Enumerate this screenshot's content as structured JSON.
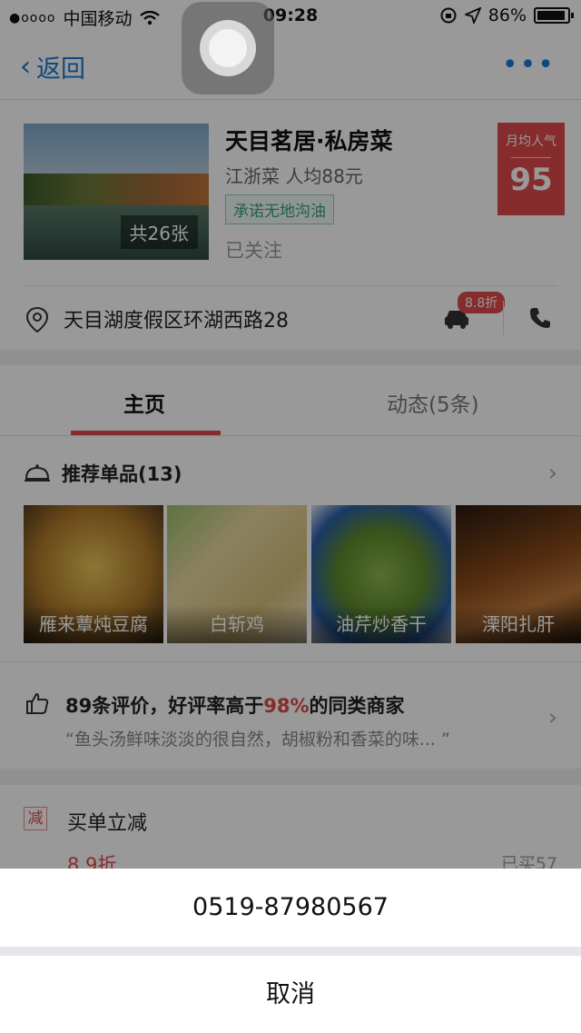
{
  "status_bar": {
    "signal_dots": "●oooo",
    "carrier": "中国移动",
    "time": "09:28",
    "battery": "86%"
  },
  "nav": {
    "back_label": "返回",
    "more_label": "•••"
  },
  "restaurant": {
    "name": "天目茗居·私房菜",
    "cuisine_price": "江浙菜 人均88元",
    "tag": "承诺无地沟油",
    "follow_status": "已关注",
    "photo_count": "共26张",
    "popularity_label": "月均人气",
    "popularity_value": "95",
    "address": "天目湖度假区环湖西路28",
    "taxi_discount": "8.8折"
  },
  "tabs": [
    {
      "label": "主页",
      "active": true
    },
    {
      "label": "动态(5条)",
      "active": false
    }
  ],
  "dishes": {
    "header": "推荐单品(13)",
    "items": [
      {
        "name": "雁来蕈炖豆腐"
      },
      {
        "name": "白斩鸡"
      },
      {
        "name": "油芹炒香干"
      },
      {
        "name": "溧阳扎肝"
      }
    ]
  },
  "reviews": {
    "prefix": "89条评价，好评率高于",
    "highlight": "98%",
    "suffix": "的同类商家",
    "quote": "“鱼头汤鲜味淡淡的很自然，胡椒粉和香菜的味... ”"
  },
  "promo": {
    "badge": "减",
    "title": "买单立减",
    "discount": "8.9折",
    "sold": "已买57"
  },
  "action_sheet": {
    "phone": "0519-87980567",
    "cancel": "取消"
  },
  "colors": {
    "accent_blue": "#1a7ad6",
    "accent_red": "#e04a4a",
    "tag_green": "#3aa07a"
  }
}
